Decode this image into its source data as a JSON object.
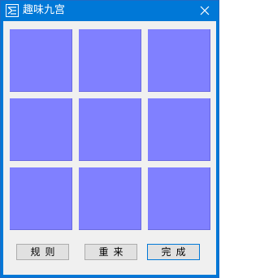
{
  "window": {
    "title": "趣味九宫",
    "app_icon": "app-logo-icon",
    "close_icon": "close-icon",
    "title_bar_color": "#0078d7",
    "client_bg": "#f0f0f0"
  },
  "board": {
    "cell_color": "#8080ff",
    "cells": [
      "",
      "",
      "",
      "",
      "",
      "",
      "",
      "",
      ""
    ]
  },
  "buttons": {
    "rules": "规则",
    "restart": "重来",
    "done": "完成"
  }
}
